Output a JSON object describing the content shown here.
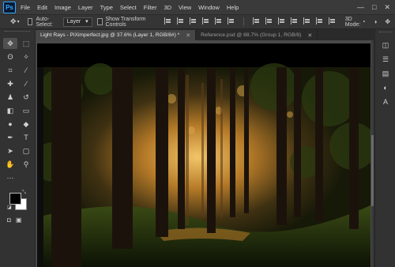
{
  "app": {
    "logo_text": "Ps",
    "menu": [
      "File",
      "Edit",
      "Image",
      "Layer",
      "Type",
      "Select",
      "Filter",
      "3D",
      "View",
      "Window",
      "Help"
    ],
    "window_controls": {
      "minimize": "—",
      "maximize": "□",
      "close": "✕"
    }
  },
  "options_bar": {
    "tool_icon": "move-tool-icon",
    "auto_select_label": "Auto-Select:",
    "auto_select_value": "Layer",
    "show_transform_label": "Show Transform Controls",
    "mode_3d_label": "3D Mode:"
  },
  "tabs": [
    {
      "label": "Light Rays - PiXimperfect.jpg @ 37.6% (Layer 1, RGB/8#) *",
      "close": "✕"
    },
    {
      "label": "Reference.psd @ 88.7% (Group 1, RGB/8)",
      "close": "✕"
    }
  ],
  "toolbar": {
    "tools": [
      {
        "name": "move-tool",
        "glyph": "✥"
      },
      {
        "name": "marquee-tool",
        "glyph": "⬚"
      },
      {
        "name": "lasso-tool",
        "glyph": "ʘ"
      },
      {
        "name": "magic-wand-tool",
        "glyph": "✧"
      },
      {
        "name": "crop-tool",
        "glyph": "⌗"
      },
      {
        "name": "eyedropper-tool",
        "glyph": "⁄"
      },
      {
        "name": "healing-brush-tool",
        "glyph": "✚"
      },
      {
        "name": "brush-tool",
        "glyph": "∕"
      },
      {
        "name": "clone-stamp-tool",
        "glyph": "♟"
      },
      {
        "name": "history-brush-tool",
        "glyph": "↺"
      },
      {
        "name": "eraser-tool",
        "glyph": "◧"
      },
      {
        "name": "gradient-tool",
        "glyph": "▭"
      },
      {
        "name": "dodge-tool",
        "glyph": "●"
      },
      {
        "name": "blur-tool",
        "glyph": "◆"
      },
      {
        "name": "pen-tool",
        "glyph": "✒"
      },
      {
        "name": "type-tool",
        "glyph": "T"
      },
      {
        "name": "path-selection-tool",
        "glyph": "➤"
      },
      {
        "name": "shape-tool",
        "glyph": "▢"
      },
      {
        "name": "hand-tool",
        "glyph": "✋"
      },
      {
        "name": "zoom-tool",
        "glyph": "⚲"
      }
    ],
    "extra": "⋯",
    "foreground_color": "#000000",
    "background_color": "#ffffff"
  },
  "right_panel": {
    "icons": [
      "layers-panel-icon",
      "properties-icon",
      "history-icon",
      "adjustments-icon",
      "character-icon"
    ]
  },
  "colors": {
    "ps_accent": "#31a8ff",
    "ui_dark": "#2b2b2b"
  }
}
